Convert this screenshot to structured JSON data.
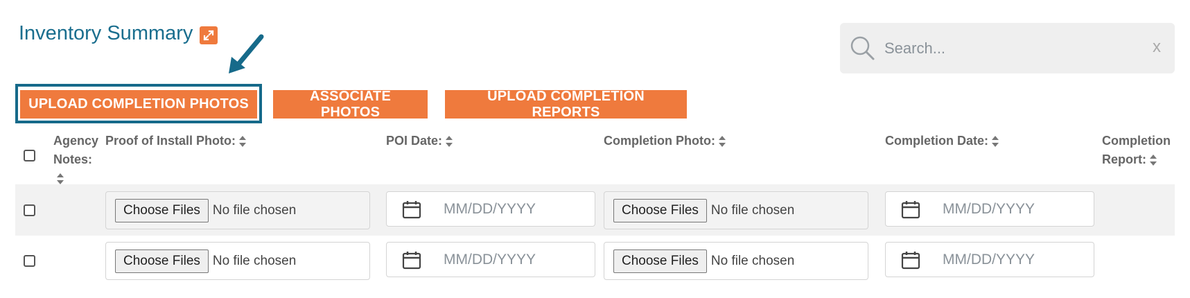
{
  "header": {
    "title": "Inventory Summary",
    "expand_icon": "expand-icon"
  },
  "search": {
    "placeholder": "Search...",
    "clear": "x"
  },
  "toolbar": {
    "upload_completion_photos": "UPLOAD COMPLETION PHOTOS",
    "associate_photos": "ASSOCIATE PHOTOS",
    "upload_completion_reports": "UPLOAD COMPLETION REPORTS"
  },
  "columns": {
    "agency_notes_1": "Agency",
    "agency_notes_2": "Notes:",
    "proof_of_install_photo": "Proof of Install Photo:",
    "poi_date": "POI Date:",
    "completion_photo": "Completion Photo:",
    "completion_date": "Completion Date:",
    "completion_report_1": "Completion",
    "completion_report_2": "Report:"
  },
  "rows": [
    {
      "poi_photo": {
        "button": "Choose Files",
        "status": "No file chosen"
      },
      "poi_date_placeholder": "MM/DD/YYYY",
      "completion_photo": {
        "button": "Choose Files",
        "status": "No file chosen"
      },
      "completion_date_placeholder": "MM/DD/YYYY"
    },
    {
      "poi_photo": {
        "button": "Choose Files",
        "status": "No file chosen"
      },
      "poi_date_placeholder": "MM/DD/YYYY",
      "completion_photo": {
        "button": "Choose Files",
        "status": "No file chosen"
      },
      "completion_date_placeholder": "MM/DD/YYYY"
    }
  ],
  "colors": {
    "accent": "#ef7a3d",
    "title": "#1a6e8e",
    "highlight": "#166a8a"
  }
}
